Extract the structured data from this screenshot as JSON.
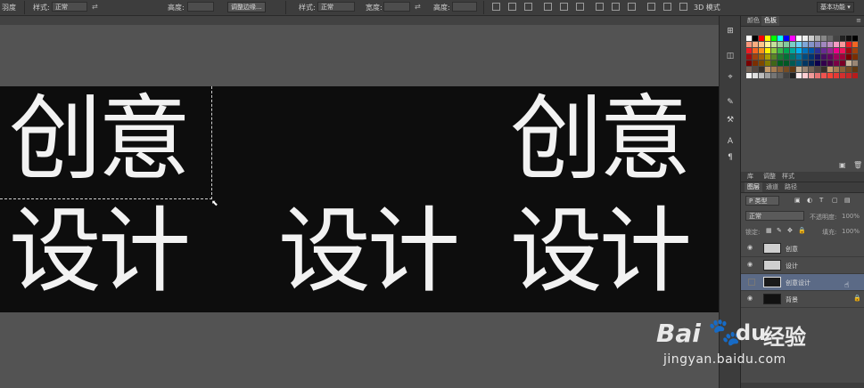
{
  "options_bar": {
    "style_label_1": "样式:",
    "style_value_1": "正常",
    "height_label_1": "高度:",
    "refine_edge_button": "调整边缘...",
    "style_label_2": "样式:",
    "style_value_2": "正常",
    "width_label_2": "宽度:",
    "height_label_2": "高度:",
    "workspace_button": "基本功能"
  },
  "canvas": {
    "glyphs_top_left": "创意",
    "glyphs_bottom_left": "设计",
    "glyphs_middle": "设计",
    "glyphs_top_right": "创意",
    "glyphs_bottom_right": "设计"
  },
  "color_panel": {
    "tabs": [
      "颜色",
      "色板"
    ],
    "active_tab": "色板"
  },
  "libraries_panel": {
    "tabs": [
      "库",
      "调整",
      "样式"
    ]
  },
  "layers_panel": {
    "tabs": [
      "图层",
      "通道",
      "路径"
    ],
    "filter_label": "P 类型",
    "blend_mode": "正常",
    "opacity_label": "不透明度:",
    "opacity_value": "100%",
    "lock_label": "锁定:",
    "fill_label": "填充:",
    "fill_value": "100%",
    "layers": [
      {
        "name": "创意",
        "visible": true,
        "selected": false
      },
      {
        "name": "设计",
        "visible": true,
        "selected": false
      },
      {
        "name": "创意设计",
        "visible": false,
        "selected": true
      },
      {
        "name": "背景",
        "visible": true,
        "selected": false,
        "locked": true
      }
    ]
  },
  "watermark": {
    "brand": "Bai",
    "brand_suffix": "du",
    "product": "经验",
    "url": "jingyan.baidu.com"
  },
  "colors": {
    "canvas_bg": "#0d0d0d",
    "workspace_bg": "#535353",
    "panel_bg": "#4a4a4a",
    "selected_layer": "#5b6a86"
  }
}
